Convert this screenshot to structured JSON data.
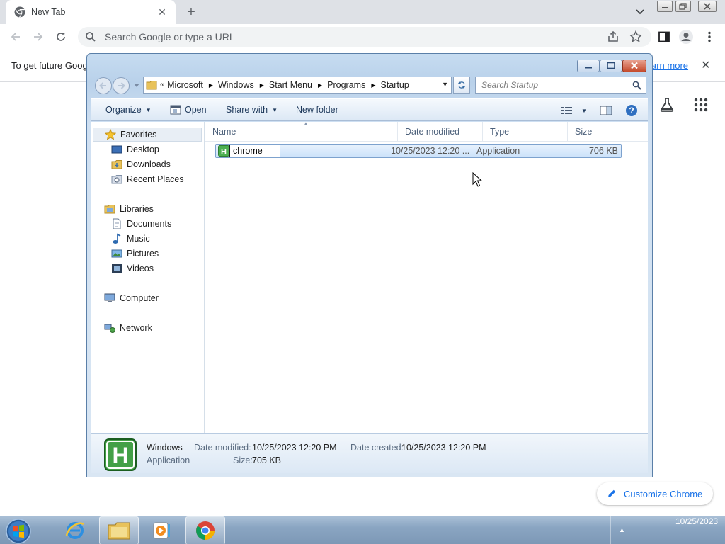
{
  "browser": {
    "tab_title": "New Tab",
    "omnibox_placeholder": "Search Google or type a URL",
    "infobar_text": "To get future Goog",
    "infobar_link": "arn more",
    "customize_label": "Customize Chrome"
  },
  "explorer": {
    "breadcrumbs": [
      "Microsoft",
      "Windows",
      "Start Menu",
      "Programs",
      "Startup"
    ],
    "search_placeholder": "Search Startup",
    "commands": {
      "organize": "Organize",
      "open": "Open",
      "share_with": "Share with",
      "new_folder": "New folder"
    },
    "nav": {
      "favorites": "Favorites",
      "desktop": "Desktop",
      "downloads": "Downloads",
      "recent_places": "Recent Places",
      "libraries": "Libraries",
      "documents": "Documents",
      "music": "Music",
      "pictures": "Pictures",
      "videos": "Videos",
      "computer": "Computer",
      "network": "Network"
    },
    "columns": {
      "name": "Name",
      "date_modified": "Date modified",
      "type": "Type",
      "size": "Size"
    },
    "file": {
      "rename_value": "chrome",
      "date_modified": "10/25/2023 12:20 ...",
      "type": "Application",
      "size": "706 KB"
    },
    "details": {
      "name": "Windows",
      "type": "Application",
      "date_modified_label": "Date modified:",
      "date_modified": "10/25/2023 12:20 PM",
      "size_label": "Size:",
      "size": "705 KB",
      "date_created_label": "Date created:",
      "date_created": "10/25/2023 12:20 PM"
    }
  },
  "taskbar": {
    "clock_date": "10/25/2023"
  },
  "colors": {
    "chrome_blue": "#1a73e8",
    "explorer_frame": "#c6dcf1",
    "file_icon_green": "#3d9a3d",
    "taskbar": "#8aa5c2"
  }
}
